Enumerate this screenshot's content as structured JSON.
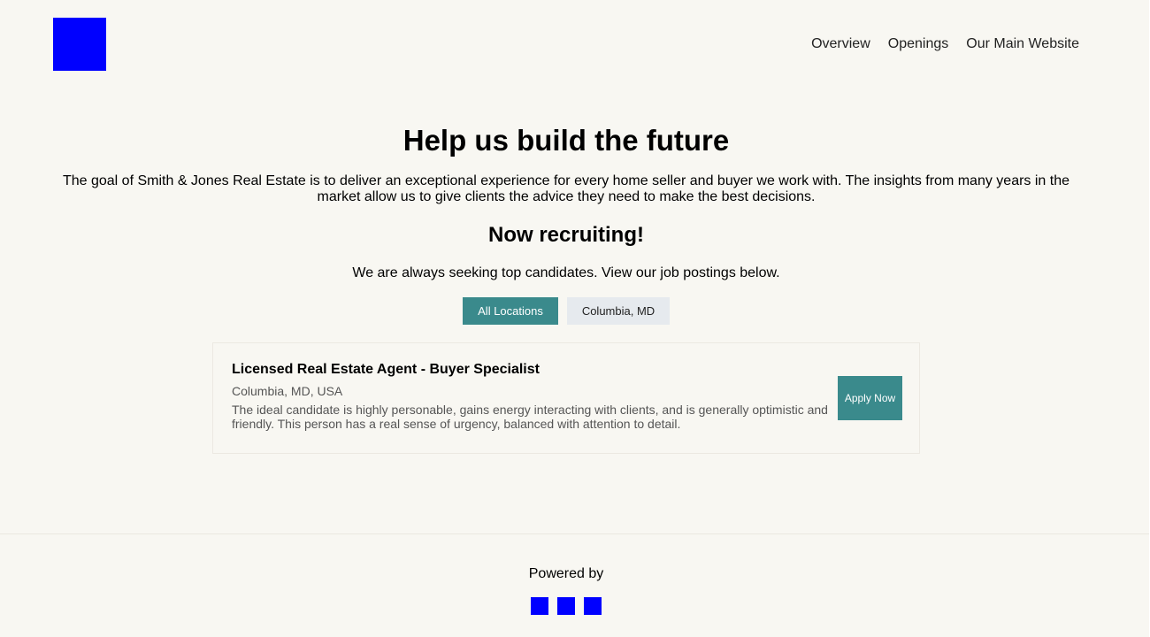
{
  "header": {
    "logo_icon": "company-logo",
    "nav": [
      "Overview",
      "Openings",
      "Our Main Website"
    ]
  },
  "hero": {
    "title": "Help us build the future",
    "intro": "The goal of Smith & Jones Real Estate is to deliver an exceptional experience for every home seller and buyer we work with. The insights from many years in the market allow us to give clients the advice they need to make the best decisions.",
    "recruiting_title": "Now recruiting!",
    "recruiting_sub": "We are always seeking top candidates. View our job postings below."
  },
  "filters": {
    "items": [
      "All Locations",
      "Columbia, MD"
    ],
    "selected": "All Locations"
  },
  "jobs": [
    {
      "title": "Licensed Real Estate Agent - Buyer Specialist",
      "location": "Columbia, MD, USA",
      "description": "The ideal candidate is highly personable, gains energy interacting with clients, and is generally optimistic and friendly. This person has a real sense of urgency, balanced with attention to detail.",
      "apply_label": "Apply Now"
    }
  ],
  "footer": {
    "powered_by": "Powered by",
    "icons": [
      "social-icon",
      "social-icon",
      "social-icon"
    ]
  },
  "colors": {
    "accent": "#3a8a8c",
    "logo": "#0000ff",
    "background": "#f8f7f2"
  }
}
